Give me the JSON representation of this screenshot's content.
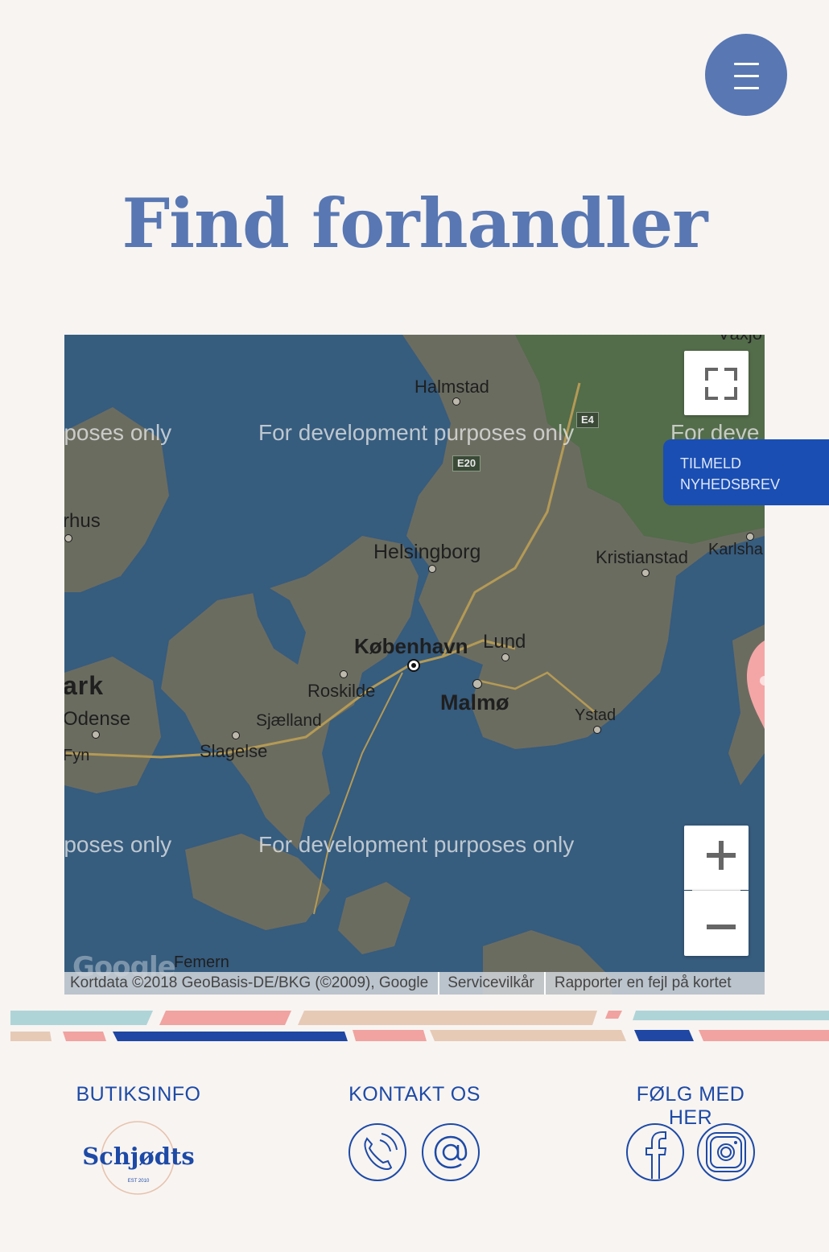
{
  "header": {
    "menu_icon": "hamburger-menu-icon",
    "title": "Find forhandler"
  },
  "map": {
    "labels": {
      "halmstad": "Halmstad",
      "helsingborg": "Helsingborg",
      "kristianstad": "Kristianstad",
      "karlsha": "Karlsha",
      "kobenhavn": "København",
      "lund": "Lund",
      "malmo": "Malmø",
      "roskilde": "Roskilde",
      "sjaelland": "Sjælland",
      "slagelse": "Slagelse",
      "ystad": "Ystad",
      "odense": "Odense",
      "fyn": "Fyn",
      "aarhus": "rhus",
      "mark": "ark",
      "femern": "Femern",
      "vaxjo": "Växjö"
    },
    "road_shields": {
      "e4": "E4",
      "e20": "E20"
    },
    "watermark": "For development purposes only",
    "watermark_left": "rposes only",
    "watermark_right": "For deve",
    "watermark_right2": "For deve",
    "watermark_right_bottom": "F   e",
    "google_logo": "Google",
    "attribution": {
      "kortdata": "Kortdata ©2018 GeoBasis-DE/BKG (©2009), Google",
      "terms": "Servicevilkår",
      "report": "Rapporter en fejl på kortet"
    },
    "controls": {
      "fullscreen_icon": "fullscreen-icon",
      "zoom_in_icon": "plus-icon",
      "zoom_out_icon": "minus-icon"
    },
    "marker_color": "#f4a6a6"
  },
  "newsletter": {
    "line1": "TILMELD",
    "line2": "NYHEDSBREV"
  },
  "footer": {
    "butiksinfo": "BUTIKSINFO",
    "kontakt": "KONTAKT OS",
    "folg": "FØLG MED HER",
    "logo_text": "Schjødts",
    "logo_est": "EST 2010",
    "icons": [
      "phone-icon",
      "at-sign-icon",
      "facebook-icon",
      "instagram-icon"
    ]
  },
  "colors": {
    "accent": "#5877b3",
    "dark_blue": "#1d4aa7",
    "newsletter_bg": "#1a4eb3",
    "background": "#f8f4f1",
    "stripe_pink": "#f0a3a0",
    "stripe_tan": "#e6cab6",
    "stripe_teal": "#aed4d8",
    "stripe_navy": "#1f47a3"
  }
}
